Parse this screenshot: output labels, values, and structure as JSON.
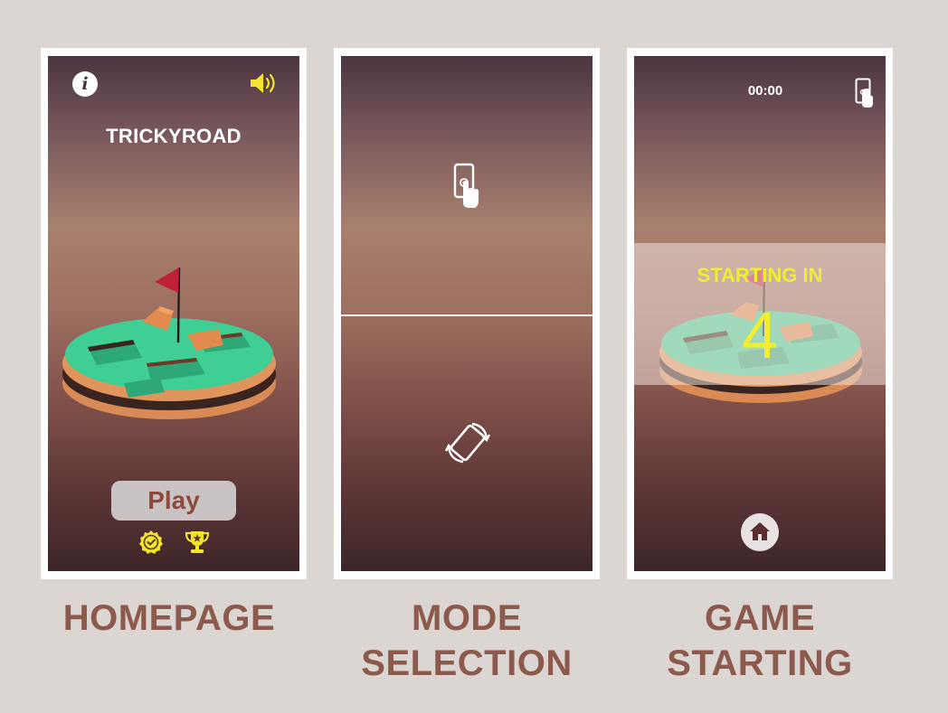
{
  "homepage": {
    "title": "TRICKYROAD",
    "play_label": "Play",
    "caption": "HOMEPAGE",
    "icons": [
      "info-icon",
      "sound-icon",
      "badge-icon",
      "trophy-icon"
    ]
  },
  "mode_selection": {
    "caption_line1": "MODE",
    "caption_line2": "SELECTION",
    "icons": [
      "touch-phone-icon",
      "tilt-rotate-icon"
    ]
  },
  "game_starting": {
    "timer": "00:00",
    "starting_label": "STARTING IN",
    "countdown": "4",
    "caption_line1": "GAME",
    "caption_line2": "STARTING",
    "icons": [
      "touch-mode-icon",
      "home-icon"
    ]
  },
  "colors": {
    "caption": "#8c5a4c",
    "accent_yellow": "#f2ee2f",
    "grass": "#3fcf94",
    "earth": "#e0955c",
    "flag": "#c0213a"
  }
}
